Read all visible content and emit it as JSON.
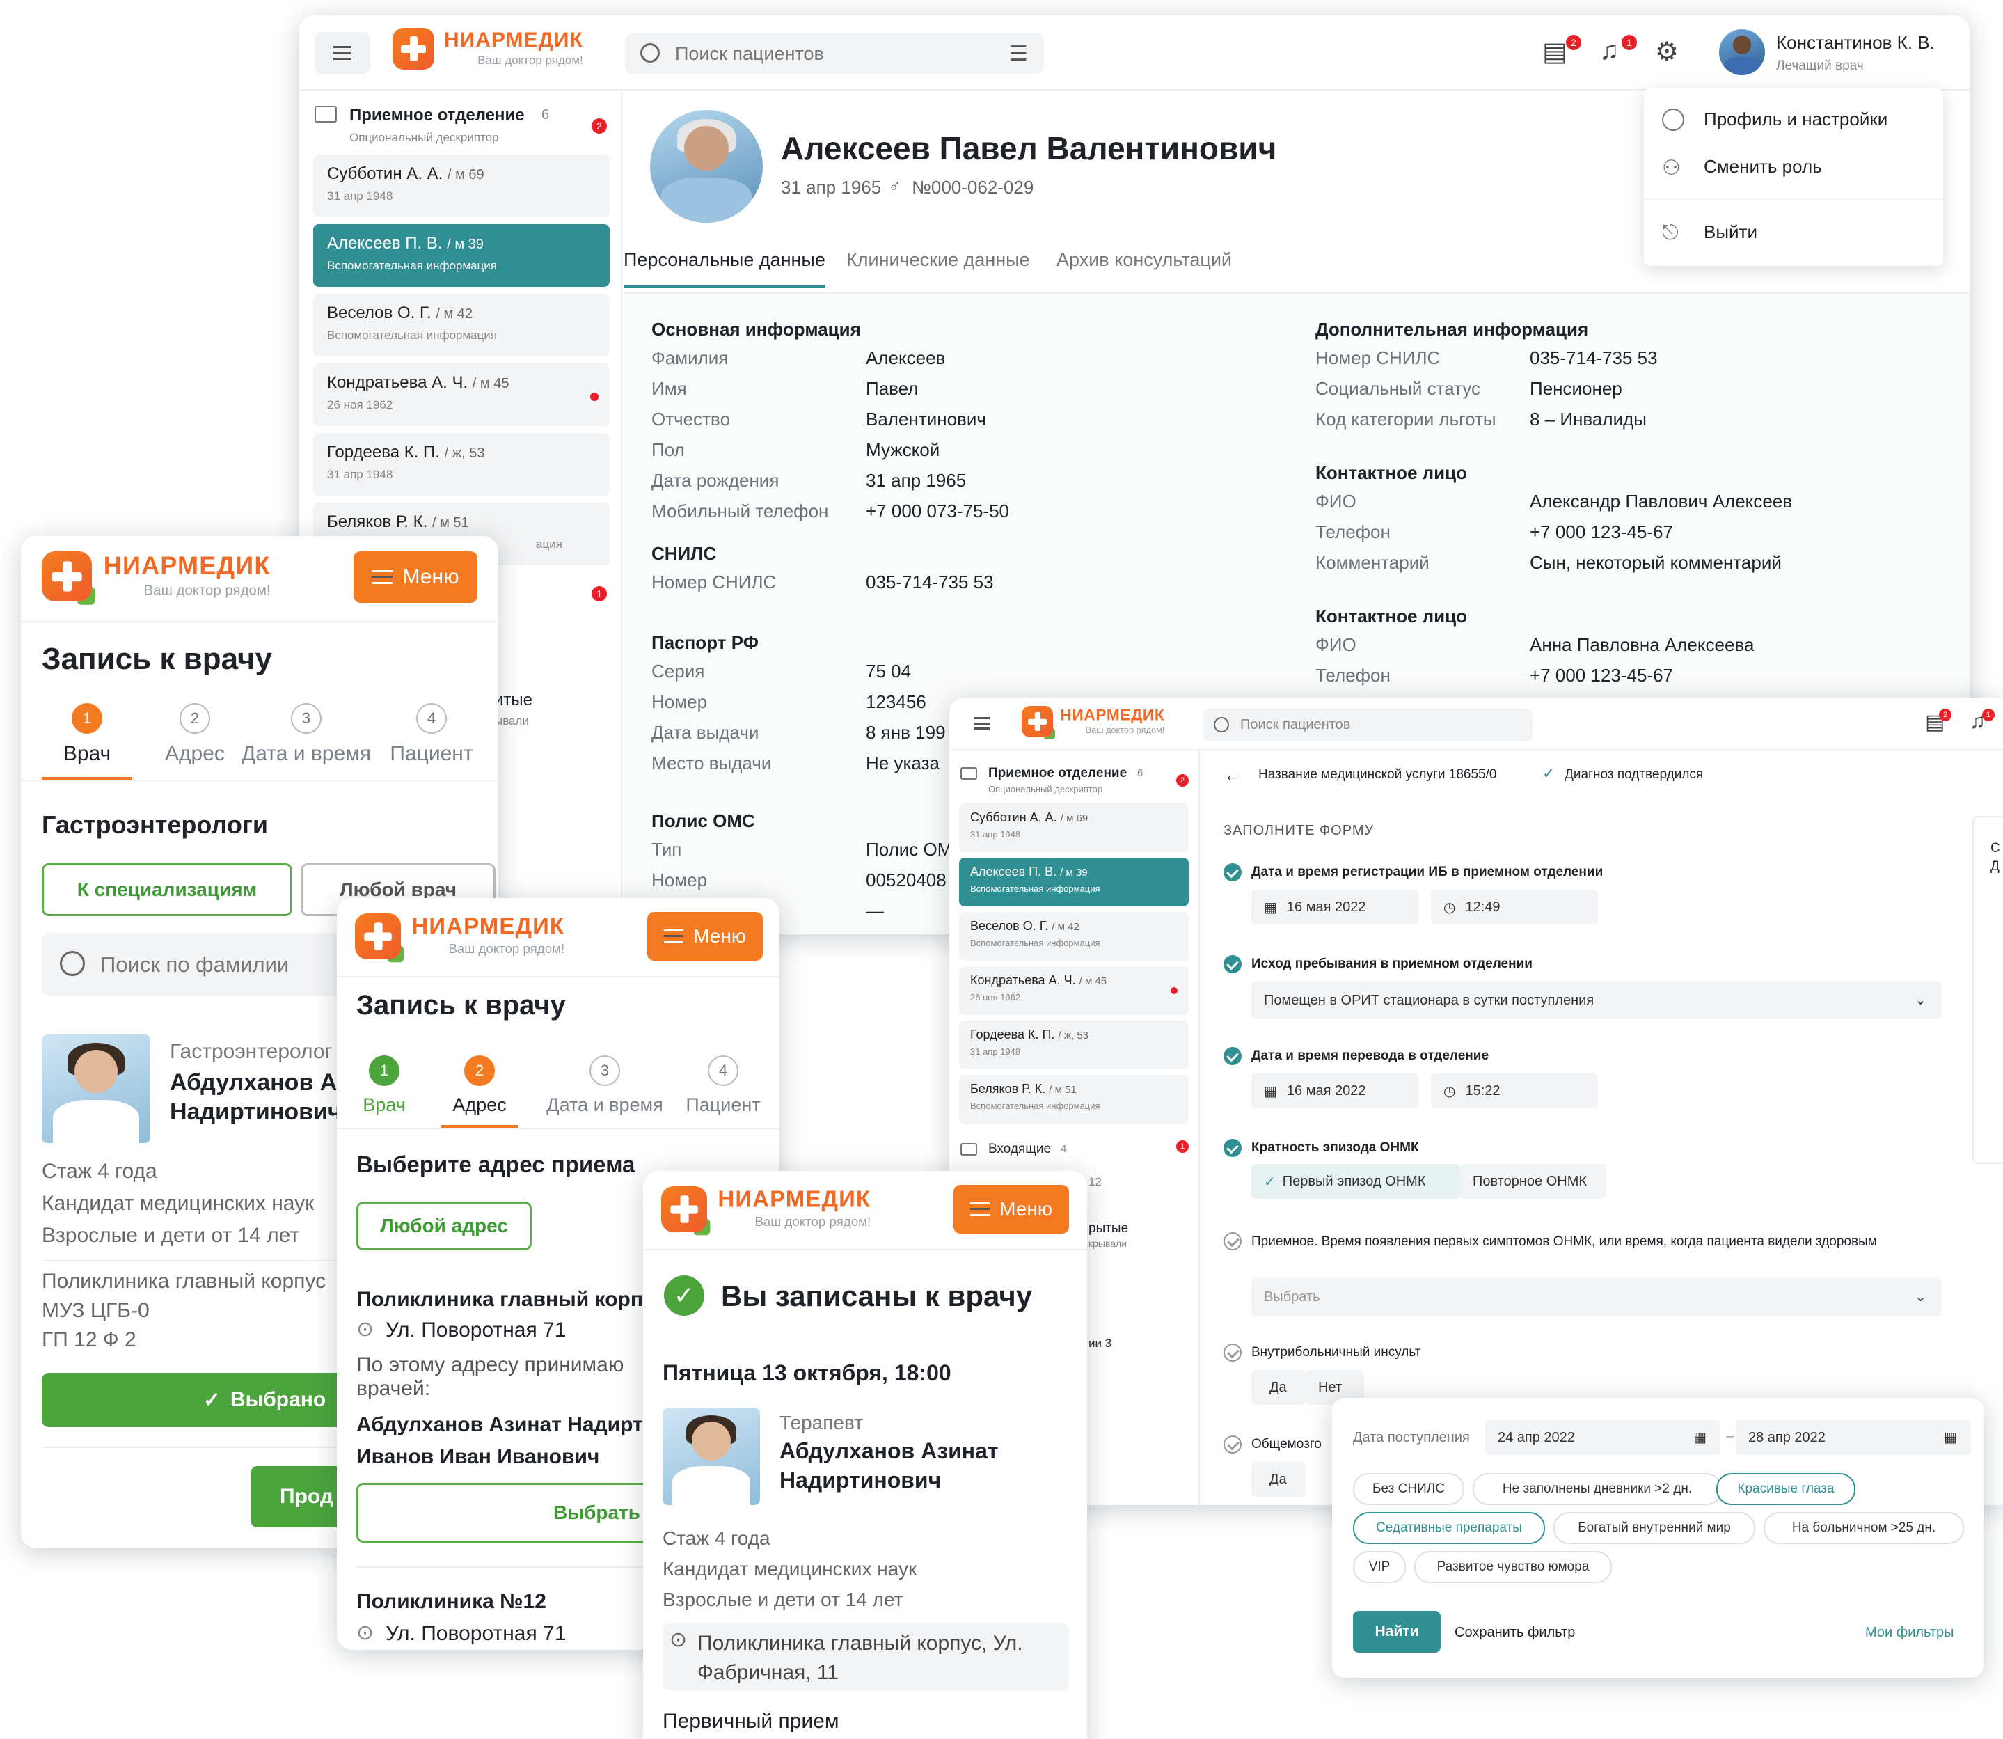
{
  "main": {
    "search_placeholder": "Поиск пациентов",
    "logo": {
      "name": "НИАРМЕДИК",
      "tagline": "Ваш доктор рядом!"
    },
    "user": {
      "name": "Константинов К. В.",
      "role": "Лечащий врач"
    },
    "badges": {
      "messages": "2",
      "notifications": "1"
    },
    "dropdown": [
      "Профиль и настройки",
      "Сменить роль",
      "Выйти"
    ],
    "folder": {
      "title": "Приемное отделение",
      "count": "6",
      "desc": "Опциональный дескриптор",
      "badge": "2"
    },
    "patients": [
      {
        "name": "Субботин А. А.",
        "meta": "м 69",
        "sub": "31 апр 1948"
      },
      {
        "name": "Алексеев П. В.",
        "meta": "м 39",
        "sub": "Вспомогательная информация"
      },
      {
        "name": "Веселов О. Г.",
        "meta": "м 42",
        "sub": "Вспомогательная информация"
      },
      {
        "name": "Кондратьева А. Ч.",
        "meta": "м 45",
        "sub": "26 ноя 1962"
      },
      {
        "name": "Гордеева К. П.",
        "meta": "ж, 53",
        "sub": "31 апр 1948"
      },
      {
        "name": "Беляков Р. К.",
        "meta": "м 51",
        "sub": "ация"
      }
    ],
    "hidden_snips": [
      "итые",
      "ывали",
      "з"
    ],
    "patient": {
      "name": "Алексеев Павел Валентинович",
      "dob": "31 апр 1965",
      "id": "№000-062-029"
    },
    "tabs": [
      "Персональные данные",
      "Клинические данные",
      "Архив консультаций"
    ],
    "basic": {
      "title": "Основная информация",
      "rows": [
        [
          "Фамилия",
          "Алексеев"
        ],
        [
          "Имя",
          "Павел"
        ],
        [
          "Отчество",
          "Валентинович"
        ],
        [
          "Пол",
          "Мужской"
        ],
        [
          "Дата рождения",
          "31 апр 1965"
        ],
        [
          "Мобильный телефон",
          "+7 000 073-75-50"
        ]
      ]
    },
    "snils": {
      "title": "СНИЛС",
      "rows": [
        [
          "Номер СНИЛС",
          "035-714-735 53"
        ]
      ]
    },
    "passport": {
      "title": "Паспорт РФ",
      "rows": [
        [
          "Серия",
          "75 04"
        ],
        [
          "Номер",
          "123456"
        ],
        [
          "Дата выдачи",
          "8 янв 199"
        ],
        [
          "Место выдачи",
          "Не указа"
        ]
      ]
    },
    "oms": {
      "title": "Полис ОМС",
      "rows": [
        [
          "Тип",
          "Полис ОМ"
        ],
        [
          "Номер",
          "00520408"
        ],
        [
          "",
          "—"
        ]
      ]
    },
    "extra": {
      "title": "Дополнительная информация",
      "rows": [
        [
          "Номер СНИЛС",
          "035-714-735 53"
        ],
        [
          "Социальный статус",
          "Пенсионер"
        ],
        [
          "Код категории льготы",
          "8 – Инвалиды"
        ]
      ]
    },
    "contact1": {
      "title": "Контактное лицо",
      "rows": [
        [
          "ФИО",
          "Александр Павлович Алексеев"
        ],
        [
          "Телефон",
          "+7 000 123-45-67"
        ],
        [
          "Комментарий",
          "Сын, некоторый комментарий"
        ]
      ]
    },
    "contact2": {
      "title": "Контактное лицо",
      "rows": [
        [
          "ФИО",
          "Анна Павловна Алексеева"
        ],
        [
          "Телефон",
          "+7 000 123-45-67"
        ]
      ]
    }
  },
  "m1": {
    "menu": "Меню",
    "title": "Запись к врачу",
    "steps": [
      "Врач",
      "Адрес",
      "Дата и время",
      "Пациент"
    ],
    "subtitle": "Гастроэнтерологи",
    "btn_spec": "К специализациям",
    "btn_any": "Любой врач",
    "search_placeholder": "Поиск по фамилии",
    "doctor": {
      "spec": "Гастроэнтеролог",
      "name1": "Абдулханов Аз",
      "name2": "Надиртинович"
    },
    "info": [
      "Стаж 4 года",
      "Кандидат медицинских наук",
      "Взрослые и дети от 14 лет"
    ],
    "clinic": [
      "Поликлиника главный корпус",
      "МУЗ ЦГБ-0",
      "ГП 12 Ф 2"
    ],
    "selected": "Выбрано",
    "next": "Прод"
  },
  "m2": {
    "menu": "Меню",
    "title": "Запись к врачу",
    "steps": [
      "Врач",
      "Адрес",
      "Дата и время",
      "Пациент"
    ],
    "subtitle": "Выберите адрес приема",
    "btn_any": "Любой адрес",
    "clinic1": "Поликлиника главный корп",
    "addr1": "Ул. Поворотная 71",
    "note": "По этому адресу принимаю врачей:",
    "docs": [
      "Абдулханов Азинат Надирт",
      "Иванов Иван Иванович"
    ],
    "choose": "Выбрать адрес",
    "clinic2": "Поликлиника №12",
    "addr2": "Ул. Поворотная 71"
  },
  "m3": {
    "menu": "Меню",
    "title": "Вы записаны к врачу",
    "date": "Пятница 13 октября, 18:00",
    "doctor": {
      "spec": "Терапевт",
      "name1": "Абдулханов Азинат",
      "name2": "Надиртинович"
    },
    "info": [
      "Стаж 4 года",
      "Кандидат медицинских наук",
      "Взрослые и дети от 14 лет"
    ],
    "address": "Поликлиника главный корпус, Ул. Фабричная, 11",
    "visit": "Первичный прием"
  },
  "form": {
    "search_placeholder": "Поиск пациентов",
    "folder": {
      "title": "Приемное отделение",
      "count": "6",
      "desc": "Опциональный дескриптор"
    },
    "inbox": {
      "title": "Входящие",
      "count": "4"
    },
    "snips": [
      "12",
      "рытые",
      "крывали",
      "ии 3"
    ],
    "service": "Название медицинской услуги 18655/0",
    "status": "Диагноз подтвердился",
    "heading": "ЗАПОЛНИТЕ ФОРМУ",
    "q1": "Дата и время регистрации ИБ в приемном отделении",
    "q1_date": "16 мая 2022",
    "q1_time": "12:49",
    "q2": "Исход пребывания в приемном отделении",
    "q2_value": "Помещен в ОРИТ стационара в сутки поступления",
    "q3": "Дата и время перевода в отделение",
    "q3_date": "16 мая 2022",
    "q3_time": "15:22",
    "q4": "Кратность эпизода ОНМК",
    "q4_opts": [
      "Первый эпизод ОНМК",
      "Повторное ОНМК"
    ],
    "q5": "Приемное. Время появления первых симптомов ОНМК, или время, когда пациента видели здоровым",
    "q5_placeholder": "Выбрать",
    "q6": "Внутрибольничный инсульт",
    "yes": "Да",
    "no": "Нет",
    "q7": "Общемозго",
    "side_snips": [
      "С",
      "Д"
    ]
  },
  "filter": {
    "label": "Дата поступления",
    "from": "24 апр 2022",
    "to": "28 апр 2022",
    "chips": [
      "Без СНИЛС",
      "Не заполнены дневники >2 дн.",
      "Красивые глаза",
      "Седативные препараты",
      "Богатый внутренний мир",
      "На больничном >25 дн.",
      "VIP",
      "Развитое чувство юмора"
    ],
    "find": "Найти",
    "save": "Сохранить фильтр",
    "mine": "Мои фильтры"
  },
  "colors": {
    "accent": "#2f8f92",
    "orange": "#f47a22",
    "green": "#4ba43c",
    "red": "#e8202a"
  }
}
